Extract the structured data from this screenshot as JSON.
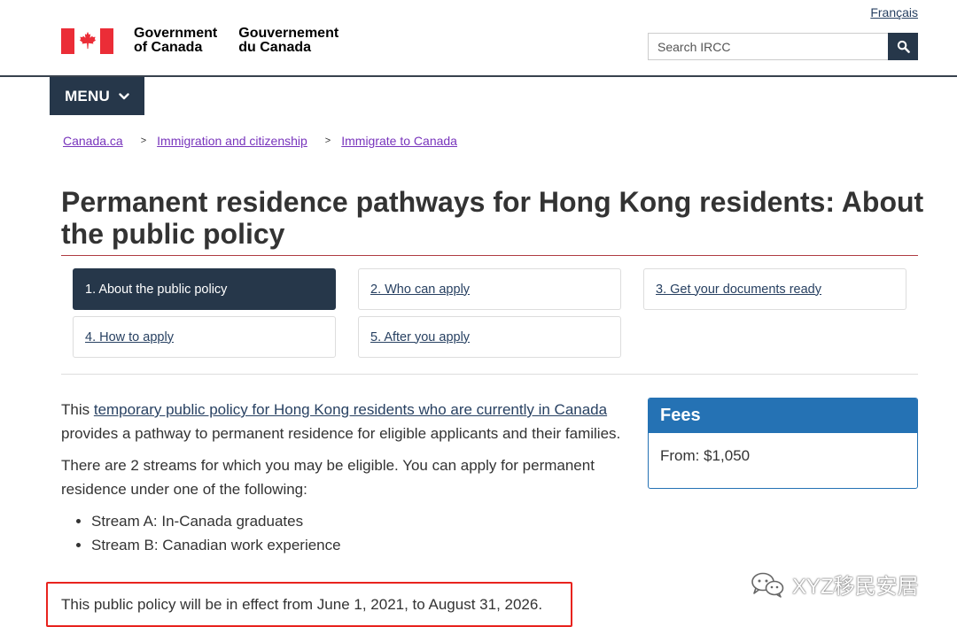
{
  "header": {
    "language_link": "Français",
    "gov_en_line1": "Government",
    "gov_en_line2": "of Canada",
    "gov_fr_line1": "Gouvernement",
    "gov_fr_line2": "du Canada",
    "search_placeholder": "Search IRCC",
    "menu_label": "MENU"
  },
  "breadcrumb": {
    "items": [
      "Canada.ca",
      "Immigration and citizenship",
      "Immigrate to Canada"
    ],
    "separator": ">"
  },
  "page": {
    "title": "Permanent residence pathways for Hong Kong residents: About the public policy"
  },
  "steps": [
    {
      "label": "1. About the public policy",
      "active": true
    },
    {
      "label": "2. Who can apply",
      "active": false
    },
    {
      "label": "3. Get your documents ready",
      "active": false
    },
    {
      "label": "4. How to apply",
      "active": false
    },
    {
      "label": "5. After you apply",
      "active": false
    }
  ],
  "content": {
    "intro_prefix": "This ",
    "intro_link": "temporary public policy for Hong Kong residents who are currently in Canada",
    "intro_suffix": " provides a pathway to permanent residence for eligible applicants and their families.",
    "streams_intro": "There are 2 streams for which you may be eligible. You can apply for permanent residence under one of the following:",
    "streams": [
      "Stream A: In-Canada graduates",
      "Stream B: Canadian work experience"
    ],
    "effect_text": "This public policy will be in effect from June 1, 2021, to August 31, 2026."
  },
  "fees": {
    "heading": "Fees",
    "amount_text": "From: $1,050"
  },
  "watermark": {
    "text": "XYZ移民安居"
  },
  "colors": {
    "flag_red": "#eb2d37",
    "nav_dark": "#26374a",
    "link": "#284162",
    "visited_link": "#7834bc",
    "title_rule": "#af3c43",
    "panel_blue": "#2572b4",
    "highlight_red": "#e8231e"
  },
  "icons": {
    "flag": "maple-leaf-icon",
    "search": "search-icon",
    "menu": "chevron-down-icon",
    "watermark": "wechat-icon"
  }
}
